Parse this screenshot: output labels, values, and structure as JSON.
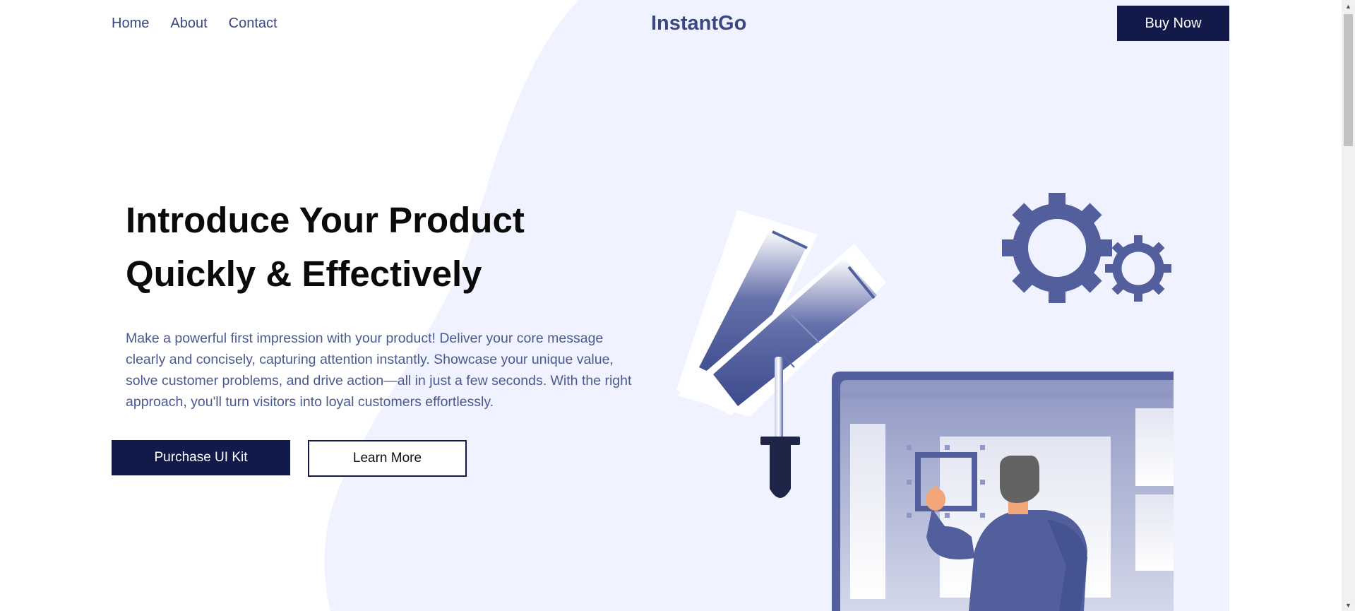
{
  "nav": {
    "links": [
      "Home",
      "About",
      "Contact"
    ],
    "brand": "InstantGo",
    "cta_label": "Buy Now"
  },
  "hero": {
    "title": "Introduce Your Product\nQuickly & Effectively",
    "description": "Make a powerful first impression with your product! Deliver your core message clearly and concisely, capturing attention instantly. Showcase your unique value, solve customer problems, and drive action—all in just a few seconds. With the right approach, you'll turn visitors into loyal customers effortlessly.",
    "primary_button": "Purchase UI Kit",
    "secondary_button": "Learn More"
  },
  "illustration": {
    "icons": [
      "color-swatch-icon",
      "eyedropper-icon",
      "gear-icon",
      "small-gear-icon",
      "person-icon",
      "monitor-icon"
    ]
  },
  "colors": {
    "primary_navy": "#111a48",
    "accent_blue": "#525f9c",
    "text_blue": "#3a4783",
    "blob_bg": "#f0f3ff"
  },
  "scrollbar": {
    "up_arrow": "▲",
    "down_arrow": "▼"
  }
}
